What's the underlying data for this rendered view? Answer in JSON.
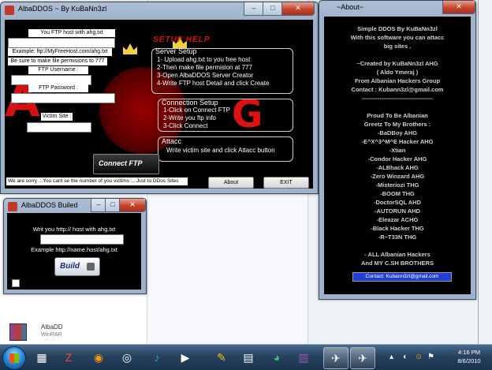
{
  "main_window": {
    "title": "AlbaDDOS ~ By KuBaNn3zl",
    "ftp_host_label": "You FTP host with ahg.txt",
    "example_label": "Example: ftp://MyFreeHost.com/ahg.txt",
    "permissions_label": "Be sure to make file permisions  to 777",
    "ftp_username_label": "FTP Username :",
    "ftp_password_label": "FTP Password :",
    "victim_site_label": "Victim Site :",
    "setup_help_title": "SETUP HELP",
    "server_setup": {
      "title": "Server Setup",
      "lines": [
        "1- Upload ahg.txt to you free host",
        "2-Then make file permision at 777",
        "3-Open AlbaDDOS Server Creator",
        "4-Write FTP host Detail and click Create"
      ]
    },
    "connection_setup": {
      "title": "Connection Setup",
      "lines": [
        "1-Click on Connect  FTP",
        "2-Write you ftp info",
        "3-Click Connect"
      ]
    },
    "attack": {
      "title": "Attacc",
      "line": "Write victim site  and click Attacc button"
    },
    "connect_ftp_label": "Connect FTP",
    "status_text": "We are sorry ...You cant se the  number  of you victims ... Just to DDos Sites",
    "about_button": "About",
    "exit_button": "EXIT",
    "logo_letters": "AHG",
    "logo_g": "G",
    "logo_a": "A"
  },
  "builder_window": {
    "title": "AlbaDDOS Builed",
    "instruction": "Writ you http:// host with ahg.txt",
    "example": "Example http://name.host/ahg.txt",
    "build_button": "Build"
  },
  "about_window": {
    "title": "~About~",
    "text": "Simple DDOS By KuBaNn3zl\nWith this software you can attacc\nbig sites .\n\n~Created by KuBaNn3zl AHG\n( Aldo Ymeraj )\nFrom Albanian Hackers Group\nContact : Kubann3zl@gmail.com\n------------------------------------\n\nProud To Be Albanian\nGreetz To My Brothers :\n-BaDBoy AHG\n-E^X^3^M^E Hacker AHG\n-Xtian\n-Condor Hacker AHG\n-ALBhack AHG\n-Zero Winzard AHG\n-Misteriozi THG\n-BOOM THG\n-DoctorSQL AHD\n-AUTORUN AHD\n-Eleazar ACHG\n-Black Hacker THG\n-R~T33N THG\n\n- ALL Albanian Hackers\nAnd MY C.SH BROTHERS",
    "contact_link": "Contact: Kubann3zl@gmail.com"
  },
  "desktop": {
    "file_name": "AlbaDD",
    "file_type": "WinRAR"
  },
  "taskbar": {
    "time": "4:16 PM",
    "date": "8/6/2010"
  },
  "colors": {
    "accent_red": "#e01010",
    "panel_red": "#d00000",
    "link_blue": "#2040d0"
  }
}
